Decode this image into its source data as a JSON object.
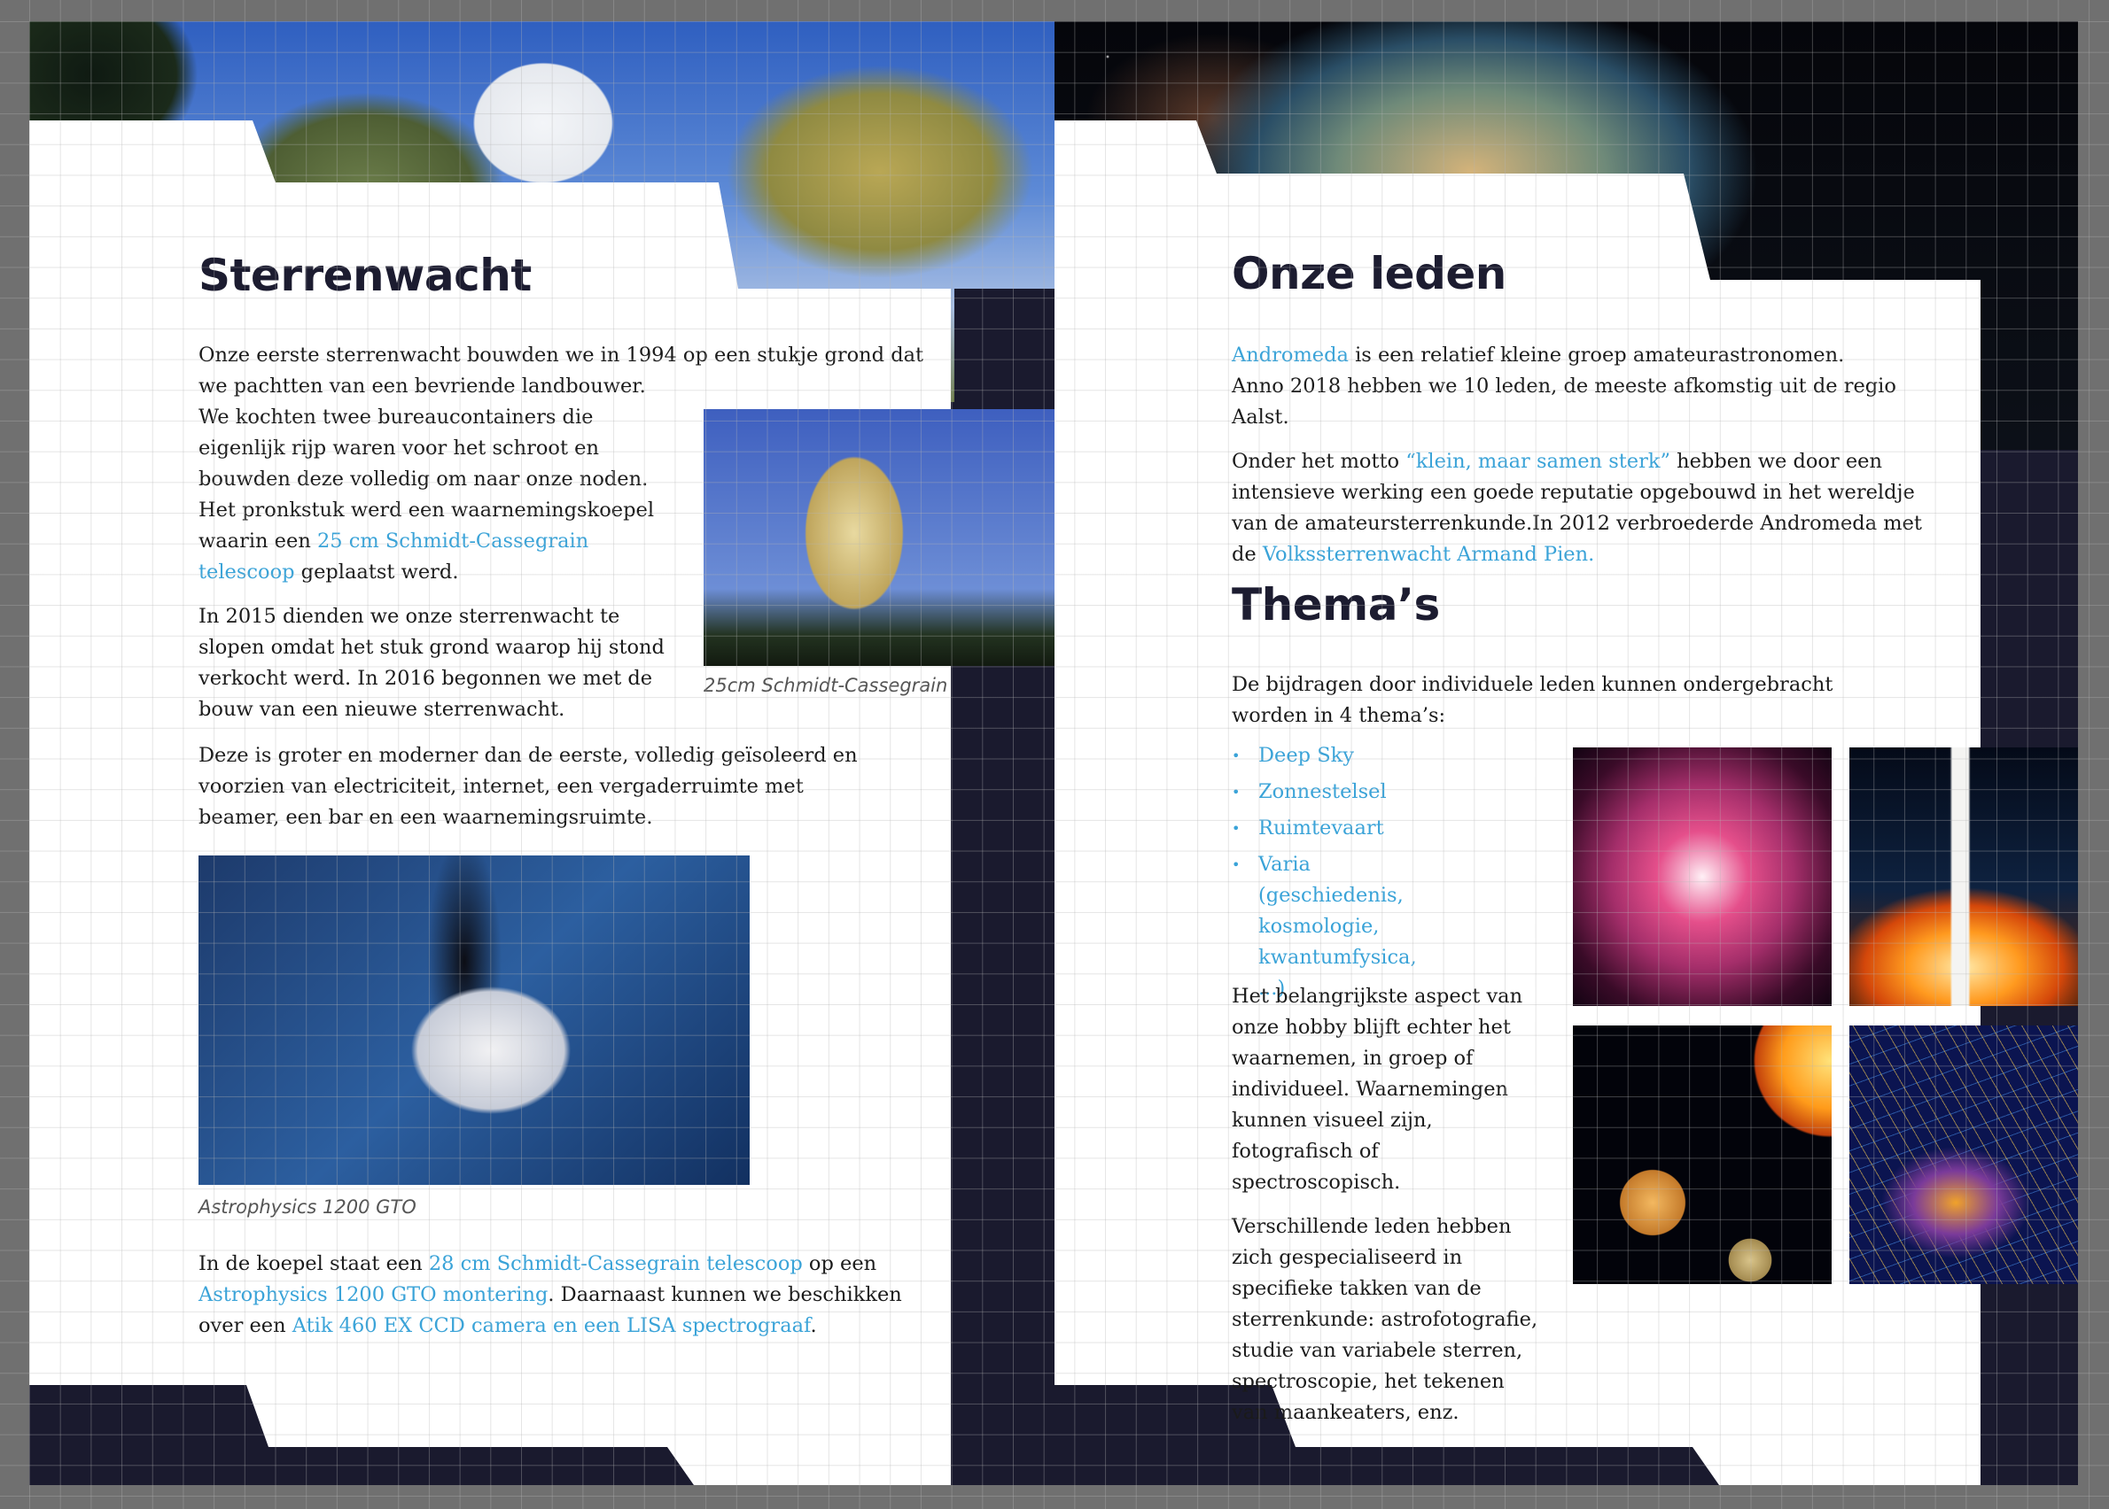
{
  "left": {
    "title": "Sterrenwacht",
    "p1": "Onze eerste sterrenwacht bouwden we in 1994 op een stukje grond dat we pachtten van een bevriende landbouwer.",
    "p2a": "We kochten twee bureaucontainers die eigenlijk rijp waren voor het schroot en bouwden deze volledig om naar onze noden. Het pronkstuk werd een waarnemingskoepel waarin een ",
    "p2link": "25 cm Schmidt-Cassegrain telescoop",
    "p2b": " geplaatst werd.",
    "p3": "In 2015 dienden we onze sterrenwacht te slopen omdat het stuk grond waarop hij stond verkocht werd. In 2016 begonnen we met de bouw van een nieuwe sterrenwacht.",
    "p4": "Deze is groter en moderner dan de eerste, volledig geïsoleerd en voorzien van electriciteit, internet, een vergaderruimte met beamer, een bar en een waarnemingsruimte.",
    "caption1": "25cm Schmidt-Cassegrain",
    "caption2": "Astrophysics 1200 GTO",
    "p5a": "In de koepel staat een ",
    "p5link1": "28 cm Schmidt-Cassegrain telescoop",
    "p5b": " op een ",
    "p5link2": "Astrophysics 1200 GTO montering",
    "p5c": ". Daarnaast kunnen we beschikken over een ",
    "p5link3": "Atik 460 EX CCD camera en een LISA spectrograaf",
    "p5d": "."
  },
  "right": {
    "title1": "Onze leden",
    "p1link": "Andromeda",
    "p1a": " is een relatief kleine groep amateurastronomen.",
    "p1b": "Anno 2018 hebben we 10 leden, de meeste afkomstig uit de regio Aalst.",
    "p2a": "Onder het motto ",
    "p2link": "“klein, maar samen sterk”",
    "p2b": " hebben we door een intensieve werking een goede reputatie opgebouwd in het wereldje van de amateursterrenkunde.In 2012 verbroederde Andromeda met de ",
    "p2link2": "Volkssterrenwacht Armand Pien.",
    "title2": "Thema’s",
    "p3": "De bijdragen door individuele leden kunnen ondergebracht worden in 4 thema’s:",
    "themes": [
      "Deep Sky",
      "Zonnestelsel",
      "Ruimtevaart",
      "Varia (geschiedenis, kosmologie, kwantumfysica, ...)"
    ],
    "p4": "Het belangrijkste aspect van onze hobby blijft echter het waarnemen, in groep of individueel. Waarnemingen kunnen visueel zijn, fotografisch of spectroscopisch.",
    "p5": "Verschillende leden hebben zich gespecialiseerd in specifieke takken van de sterrenkunde: astrofotografie, studie van variabele sterren, spectroscopie, het tekenen van maankeaters, enz."
  },
  "colors": {
    "accent": "#3aa3d8",
    "dark": "#1a1a2e",
    "heading": "#1c1c30"
  }
}
